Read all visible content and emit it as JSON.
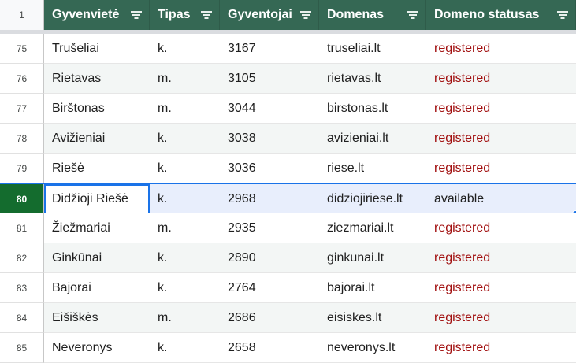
{
  "header": {
    "row_number": "1",
    "columns": [
      "Gyvenvietė",
      "Tipas",
      "Gyventojai",
      "Domenas",
      "Domeno statusas"
    ]
  },
  "rows": [
    {
      "n": "75",
      "name": "Trušeliai",
      "type": "k.",
      "pop": "3167",
      "domain": "truseliai.lt",
      "status": "registered"
    },
    {
      "n": "76",
      "name": "Rietavas",
      "type": "m.",
      "pop": "3105",
      "domain": "rietavas.lt",
      "status": "registered"
    },
    {
      "n": "77",
      "name": "Birštonas",
      "type": "m.",
      "pop": "3044",
      "domain": "birstonas.lt",
      "status": "registered"
    },
    {
      "n": "78",
      "name": "Avižieniai",
      "type": "k.",
      "pop": "3038",
      "domain": "avizieniai.lt",
      "status": "registered"
    },
    {
      "n": "79",
      "name": "Riešė",
      "type": "k.",
      "pop": "3036",
      "domain": "riese.lt",
      "status": "registered"
    },
    {
      "n": "80",
      "name": "Didžioji Riešė",
      "type": "k.",
      "pop": "2968",
      "domain": "didziojiriese.lt",
      "status": "available"
    },
    {
      "n": "81",
      "name": "Žiežmariai",
      "type": "m.",
      "pop": "2935",
      "domain": "ziezmariai.lt",
      "status": "registered"
    },
    {
      "n": "82",
      "name": "Ginkūnai",
      "type": "k.",
      "pop": "2890",
      "domain": "ginkunai.lt",
      "status": "registered"
    },
    {
      "n": "83",
      "name": "Bajorai",
      "type": "k.",
      "pop": "2764",
      "domain": "bajorai.lt",
      "status": "registered"
    },
    {
      "n": "84",
      "name": "Eišiškės",
      "type": "m.",
      "pop": "2686",
      "domain": "eisiskes.lt",
      "status": "registered"
    },
    {
      "n": "85",
      "name": "Neveronys",
      "type": "k.",
      "pop": "2658",
      "domain": "neveronys.lt",
      "status": "registered"
    }
  ],
  "selected_row": "80",
  "colors": {
    "header_bg": "#356854",
    "registered": "#a10f0f",
    "selection": "#1a73e8",
    "selected_rownum": "#146c2e"
  }
}
